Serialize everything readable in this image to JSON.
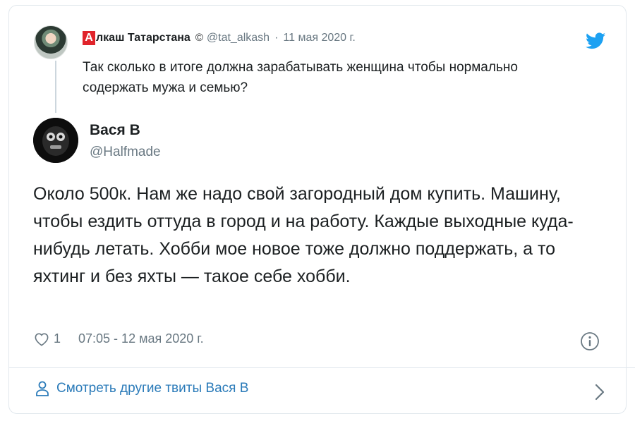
{
  "parent_tweet": {
    "brand_letter": "А",
    "display_name_rest": "лкаш Татарстана",
    "copyright": "©",
    "handle": "@tat_alkash",
    "separator": "·",
    "date": "11 мая 2020 г.",
    "text": "Так сколько в итоге должна зарабатывать женщина чтобы нормально содержать мужа и семью?"
  },
  "tweet": {
    "display_name": "Вася В",
    "handle": "@Halfmade",
    "text": "Около 500к.  Нам же надо свой загородный дом купить. Машину, чтобы ездить оттуда в город и на работу. Каждые выходные куда-нибудь летать. Хобби мое новое тоже должно поддержать, а то яхтинг и без яхты — такое себе хобби.",
    "like_count": "1",
    "timestamp": "07:05 - 12 мая 2020 г."
  },
  "footer": {
    "more_tweets_label": "Смотреть другие твиты Вася В"
  },
  "icons": {
    "brand": "twitter-bird-icon",
    "like": "heart-icon",
    "info": "info-icon",
    "more": "person-icon",
    "chevron": "chevron-right-icon"
  },
  "colors": {
    "twitter_blue": "#1da1f2",
    "link": "#2b7bb9",
    "muted": "#697882",
    "brand_red": "#e0242b",
    "border": "#e1e8ed"
  }
}
